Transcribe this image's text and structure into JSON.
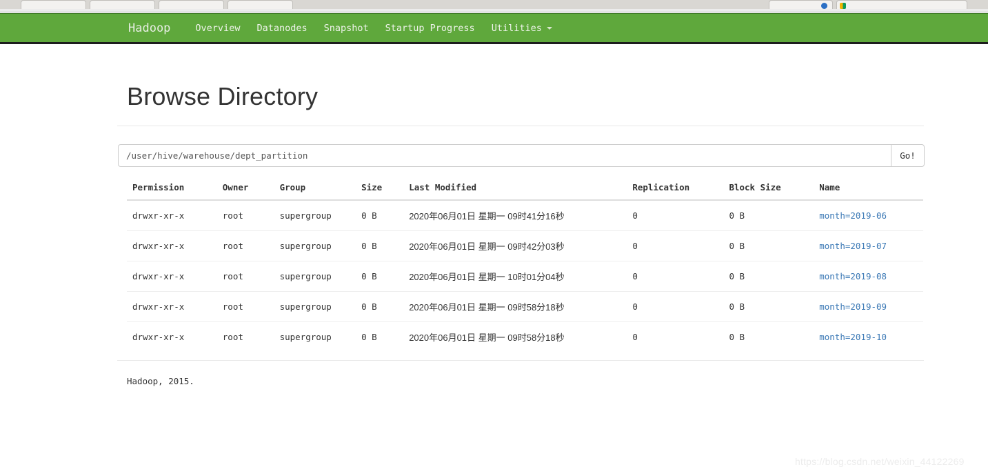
{
  "browser": {
    "tabs": [
      {
        "title": "",
        "favicon": "blue-circle-favicon"
      },
      {
        "title": "",
        "favicon": "google-favicon"
      }
    ]
  },
  "navbar": {
    "brand": "Hadoop",
    "brand_color": "#5FA83C",
    "items": [
      {
        "label": "Overview",
        "has_caret": false
      },
      {
        "label": "Datanodes",
        "has_caret": false
      },
      {
        "label": "Snapshot",
        "has_caret": false
      },
      {
        "label": "Startup Progress",
        "has_caret": false
      },
      {
        "label": "Utilities",
        "has_caret": true
      }
    ]
  },
  "page": {
    "title": "Browse Directory"
  },
  "path_form": {
    "value": "/user/hive/warehouse/dept_partition",
    "placeholder": "/user/hive/warehouse/dept_partition",
    "go_label": "Go!"
  },
  "table": {
    "columns": [
      "Permission",
      "Owner",
      "Group",
      "Size",
      "Last Modified",
      "Replication",
      "Block Size",
      "Name"
    ],
    "rows": [
      {
        "permission": "drwxr-xr-x",
        "owner": "root",
        "group": "supergroup",
        "size": "0 B",
        "last_modified": "2020年06月01日 星期一 09时41分16秒",
        "replication": "0",
        "block_size": "0 B",
        "name": "month=2019-06"
      },
      {
        "permission": "drwxr-xr-x",
        "owner": "root",
        "group": "supergroup",
        "size": "0 B",
        "last_modified": "2020年06月01日 星期一 09时42分03秒",
        "replication": "0",
        "block_size": "0 B",
        "name": "month=2019-07"
      },
      {
        "permission": "drwxr-xr-x",
        "owner": "root",
        "group": "supergroup",
        "size": "0 B",
        "last_modified": "2020年06月01日 星期一 10时01分04秒",
        "replication": "0",
        "block_size": "0 B",
        "name": "month=2019-08"
      },
      {
        "permission": "drwxr-xr-x",
        "owner": "root",
        "group": "supergroup",
        "size": "0 B",
        "last_modified": "2020年06月01日 星期一 09时58分18秒",
        "replication": "0",
        "block_size": "0 B",
        "name": "month=2019-09"
      },
      {
        "permission": "drwxr-xr-x",
        "owner": "root",
        "group": "supergroup",
        "size": "0 B",
        "last_modified": "2020年06月01日 星期一 09时58分18秒",
        "replication": "0",
        "block_size": "0 B",
        "name": "month=2019-10"
      }
    ]
  },
  "footer": {
    "text": "Hadoop, 2015."
  },
  "watermark": {
    "text": "https://blog.csdn.net/weixin_44122269"
  },
  "colors": {
    "navbar_green": "#5FA83C",
    "link_blue": "#3a78b5",
    "text_dark": "#333333"
  }
}
